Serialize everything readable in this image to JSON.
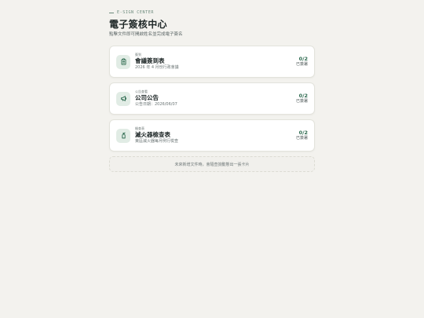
{
  "header": {
    "eyebrow": "E-SIGN CENTER",
    "title": "電子簽核中心",
    "subtitle": "點擊文件即可開啟姓名並完成電子簽名"
  },
  "colors": {
    "accent": "#2d6a4f",
    "icon_bg": "#e1ece5",
    "page_bg": "#f3f2ee"
  },
  "cards": [
    {
      "icon": "clipboard-icon",
      "tag": "簽到",
      "title": "會議簽到表",
      "desc": "2026 年 4 月份行政會議",
      "count": "0/2",
      "status": "已簽署"
    },
    {
      "icon": "megaphone-icon",
      "tag": "公告查看",
      "title": "公司公告",
      "desc": "公告日期：2026/06/07",
      "count": "0/2",
      "status": "已簽署"
    },
    {
      "icon": "fire-extinguisher-icon",
      "tag": "檢查表",
      "title": "滅火器檢查表",
      "desc": "東區滅火器每月例行檢查",
      "count": "0/2",
      "status": "已簽署"
    }
  ],
  "footer": {
    "text": "未來新增文件時，會隨查詢動態出一張卡片"
  }
}
